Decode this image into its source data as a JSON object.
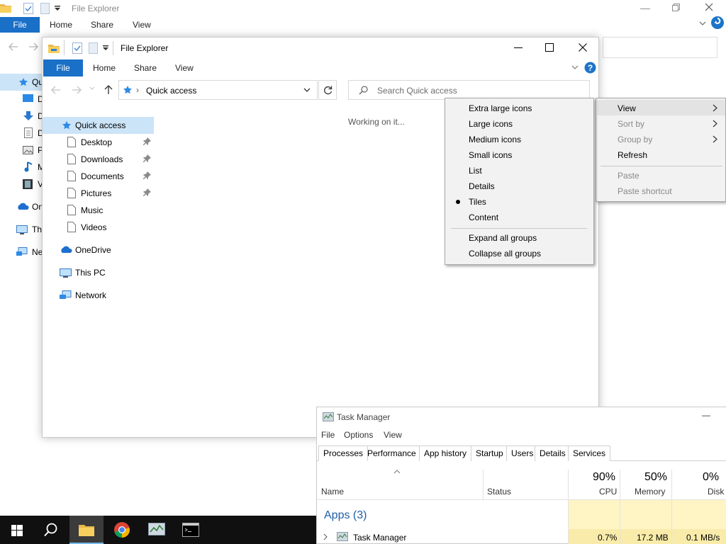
{
  "background_explorer": {
    "title": "File Explorer",
    "tabs": {
      "file": "File",
      "home": "Home",
      "share": "Share",
      "view": "View"
    },
    "nav_labels": [
      "Qu",
      "D",
      "D",
      "D",
      "P",
      "M",
      "V",
      "On",
      "Th",
      "Ne"
    ]
  },
  "explorer": {
    "title": "File Explorer",
    "tabs": {
      "file": "File",
      "home": "Home",
      "share": "Share",
      "view": "View"
    },
    "address": "Quick access",
    "search_placeholder": "Search Quick access",
    "status": "Working on it...",
    "nav": {
      "quick_access": "Quick access",
      "pinned": [
        "Desktop",
        "Downloads",
        "Documents",
        "Pictures"
      ],
      "others": [
        "Music",
        "Videos"
      ],
      "onedrive": "OneDrive",
      "this_pc": "This PC",
      "network": "Network"
    }
  },
  "view_submenu": {
    "items": [
      "Extra large icons",
      "Large icons",
      "Medium icons",
      "Small icons",
      "List",
      "Details",
      "Tiles",
      "Content"
    ],
    "selected": "Tiles",
    "group_items": [
      "Expand all groups",
      "Collapse all groups"
    ]
  },
  "context_menu": {
    "view": "View",
    "sort_by": "Sort by",
    "group_by": "Group by",
    "refresh": "Refresh",
    "paste": "Paste",
    "paste_shortcut": "Paste shortcut"
  },
  "task_manager": {
    "title": "Task Manager",
    "menu": {
      "file": "File",
      "options": "Options",
      "view": "View"
    },
    "tabs": [
      "Processes",
      "Performance",
      "App history",
      "Startup",
      "Users",
      "Details",
      "Services"
    ],
    "columns": {
      "name": "Name",
      "status": "Status",
      "cpu": "CPU",
      "memory": "Memory",
      "disk": "Disk"
    },
    "totals": {
      "cpu": "90%",
      "memory": "50%",
      "disk": "0%"
    },
    "group": "Apps (3)",
    "rows": [
      {
        "name": "Task Manager",
        "cpu": "0.7%",
        "memory": "17.2 MB",
        "disk": "0.1 MB/s"
      }
    ]
  },
  "colors": {
    "accent": "#1a6fc7",
    "selection": "#cce4f7",
    "taskbar": "#101010"
  }
}
